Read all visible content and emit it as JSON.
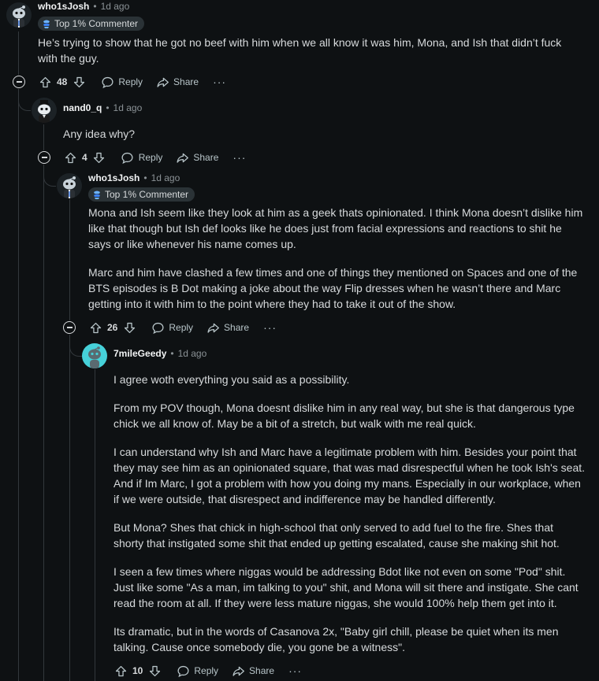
{
  "comments": [
    {
      "author": "who1sJosh",
      "time": "1d ago",
      "flair": "Top 1% Commenter",
      "paragraphs": [
        "He’s trying to show that he got no beef with him when we all know it was him, Mona, and Ish that didn’t fuck with the guy."
      ],
      "votes": "48",
      "reply_label": "Reply",
      "share_label": "Share",
      "more_label": "···"
    },
    {
      "author": "nand0_q",
      "time": "1d ago",
      "paragraphs": [
        "Any idea why?"
      ],
      "votes": "4",
      "reply_label": "Reply",
      "share_label": "Share",
      "more_label": "···"
    },
    {
      "author": "who1sJosh",
      "time": "1d ago",
      "flair": "Top 1% Commenter",
      "paragraphs": [
        "Mona and Ish seem like they look at him as a geek thats opinionated. I think Mona doesn’t dislike him like that though but Ish def looks like he does just from facial expressions and reactions to shit he says or like whenever his name comes up.",
        "Marc and him have clashed a few times and one of things they mentioned on Spaces and one of the BTS episodes is B Dot making a joke about the way Flip dresses when he wasn’t there and Marc getting into it with him to the point where they had to take it out of the show."
      ],
      "votes": "26",
      "reply_label": "Reply",
      "share_label": "Share",
      "more_label": "···"
    },
    {
      "author": "7mileGeedy",
      "time": "1d ago",
      "paragraphs": [
        "I agree woth everything you said as a possibility.",
        "From my POV though, Mona doesnt dislike him in any real way, but she is that dangerous type chick we all know of. May be a bit of a stretch, but walk with me real quick.",
        "I can understand why Ish and Marc have a legitimate problem with him. Besides your point that they may see him as an opinionated square, that was mad disrespectful when he took Ish's seat. And if Im Marc, I got a problem with how you doing my mans. Especially in our workplace, when if we were outside, that disrespect and indifference may be handled differently.",
        "But Mona? Shes that chick in high-school that only served to add fuel to the fire. Shes that shorty that instigated some shit that ended up getting escalated, cause she making shit hot.",
        "I seen a few times where niggas would be addressing Bdot like not even on some \"Pod\" shit. Just like some \"As a man, im talking to you\" shit, and Mona will sit there and instigate. She cant read the room at all. If they were less mature niggas, she would 100% help them get into it.",
        "Its dramatic, but in the words of Casanova 2x, \"Baby girl chill, please be quiet when its men talking. Cause once somebody die, you gone be a witness\"."
      ],
      "votes": "10",
      "reply_label": "Reply",
      "share_label": "Share",
      "more_label": "···"
    }
  ],
  "colors": {
    "background": "#0e1113",
    "thread_line": "#33383c",
    "text": "#d7dadc",
    "muted": "#8b9296",
    "flair_bg": "#2a3236",
    "avatar_teal": "#46d1d9"
  },
  "icons": [
    "collapse-icon",
    "upvote-icon",
    "downvote-icon",
    "reply-icon",
    "share-icon",
    "more-icon",
    "flair-icon"
  ]
}
